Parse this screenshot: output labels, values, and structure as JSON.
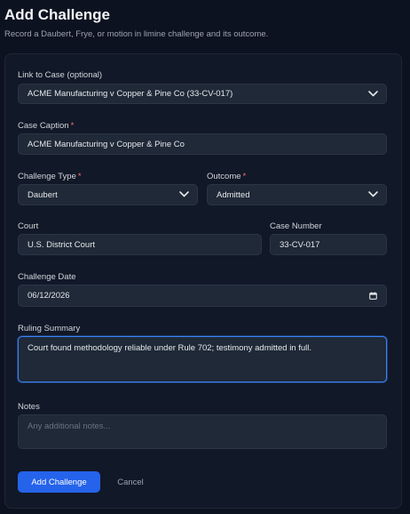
{
  "header": {
    "title": "Add Challenge",
    "subtitle": "Record a Daubert, Frye, or motion in limine challenge and its outcome."
  },
  "form": {
    "link_case": {
      "label": "Link to Case (optional)",
      "value": "ACME Manufacturing v Copper & Pine Co (33-CV-017)"
    },
    "case_caption": {
      "label": "Case Caption",
      "required_mark": "*",
      "value": "ACME Manufacturing v Copper & Pine Co"
    },
    "challenge_type": {
      "label": "Challenge Type",
      "required_mark": "*",
      "value": "Daubert"
    },
    "outcome": {
      "label": "Outcome",
      "required_mark": "*",
      "value": "Admitted"
    },
    "court": {
      "label": "Court",
      "value": "U.S. District Court"
    },
    "case_number": {
      "label": "Case Number",
      "value": "33-CV-017"
    },
    "challenge_date": {
      "label": "Challenge Date",
      "value": "06/12/2026"
    },
    "ruling_summary": {
      "label": "Ruling Summary",
      "value": "Court found methodology reliable under Rule 702; testimony admitted in full."
    },
    "notes": {
      "label": "Notes",
      "placeholder": "Any additional notes..."
    }
  },
  "actions": {
    "submit_label": "Add Challenge",
    "cancel_label": "Cancel"
  },
  "colors": {
    "background": "#0d1220",
    "card": "#111827",
    "field": "#1f2937",
    "accent": "#2563eb",
    "required": "#f87171",
    "focus_ring": "#3b82f6"
  },
  "icons": {
    "select_indicator": "chevron-down-icon",
    "date_picker": "calendar-icon"
  }
}
